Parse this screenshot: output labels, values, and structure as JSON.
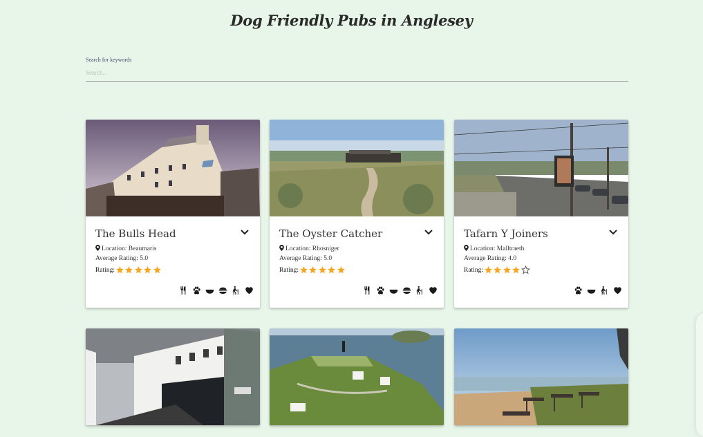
{
  "page": {
    "title": "Dog Friendly Pubs in Anglesey"
  },
  "search": {
    "label": "Search for keywords",
    "placeholder": "Search..."
  },
  "cards": [
    {
      "name": "The Bulls Head",
      "location_label": "Location:",
      "location": "Beaumaris",
      "avg_label": "Average Rating:",
      "avg": "5.0",
      "rating_label": "Rating:",
      "stars": 5,
      "icons": [
        "food-icon",
        "paw-icon",
        "bowl-icon",
        "dog-food-icon",
        "walking-icon",
        "heart-icon"
      ]
    },
    {
      "name": "The Oyster Catcher",
      "location_label": "Location:",
      "location": "Rhosniger",
      "avg_label": "Average Rating:",
      "avg": "5.0",
      "rating_label": "Rating:",
      "stars": 5,
      "icons": [
        "food-icon",
        "paw-icon",
        "bowl-icon",
        "dog-food-icon",
        "walking-icon",
        "heart-icon"
      ]
    },
    {
      "name": "Tafarn Y Joiners",
      "location_label": "Location:",
      "location": "Malltraeth",
      "avg_label": "Average Rating:",
      "avg": "4.0",
      "rating_label": "Rating:",
      "stars": 4,
      "icons": [
        "paw-icon",
        "bowl-icon",
        "walking-icon",
        "heart-icon"
      ]
    },
    {
      "name": "",
      "photo": "street-hotel-photo"
    },
    {
      "name": "",
      "photo": "lighthouse-coast-photo"
    },
    {
      "name": "",
      "photo": "terrace-beach-photo"
    }
  ],
  "colors": {
    "background": "#e8f5e9",
    "star": "#f5a623",
    "icon": "#1a1a1a"
  }
}
